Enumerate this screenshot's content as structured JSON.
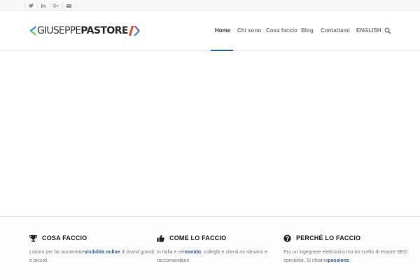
{
  "topbar": {
    "social": [
      "twitter-icon",
      "linkedin-icon",
      "google-plus-icon",
      "mail-icon"
    ]
  },
  "header": {
    "logo": {
      "text_light": "GIUSEPPE",
      "text_bold": "PASTORE",
      "colors": [
        "#1a9fd9",
        "#7dc143",
        "#e8432d",
        "#8c5aa8"
      ]
    },
    "nav": {
      "items": [
        "Home",
        "Chi sono",
        "Cosa faccio",
        "Blog",
        "Contattami",
        "ENGLISH"
      ],
      "active": "Home",
      "accent": "#2d6aa6"
    },
    "search_icon": "search-icon"
  },
  "features": [
    {
      "icon": "trophy-icon",
      "title": "COSA FACCIO",
      "text_before": "Lavoro per far aumentare",
      "link": "visibilità online",
      "text_after": " di brand grandi e piccoli."
    },
    {
      "icon": "thumbs-up-icon",
      "title": "COME LO FACCIO",
      "text_before": "In Italia e nel",
      "link": "mondo",
      "text_after": ", colleghi e clienti mi stimano e raccomandano."
    },
    {
      "icon": "question-icon",
      "title": "PERCHÉ LO FACCIO",
      "text_before": "Ero un ingegnere elettronico ma ho scelto di essere SEO specialist. Si chiama",
      "link": "passione",
      "text_after": "."
    }
  ]
}
